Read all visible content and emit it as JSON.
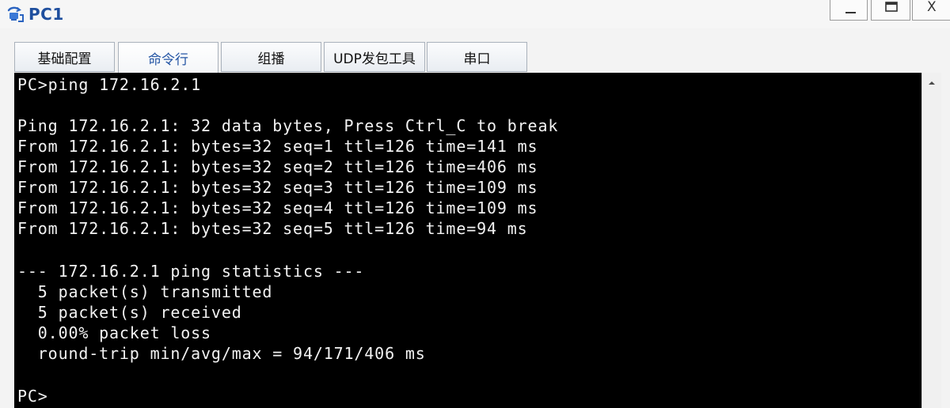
{
  "window": {
    "title": "PC1",
    "close_glyph": "X",
    "icons": [
      "pc-app-icon",
      "minimize-icon",
      "maximize-icon",
      "close-icon"
    ]
  },
  "tabs": [
    {
      "label": "基础配置",
      "active": false
    },
    {
      "label": "命令行",
      "active": true
    },
    {
      "label": "组播",
      "active": false
    },
    {
      "label": "UDP发包工具",
      "active": false
    },
    {
      "label": "串口",
      "active": false
    }
  ],
  "terminal": {
    "lines": [
      "PC>ping 172.16.2.1",
      "",
      "Ping 172.16.2.1: 32 data bytes, Press Ctrl_C to break",
      "From 172.16.2.1: bytes=32 seq=1 ttl=126 time=141 ms",
      "From 172.16.2.1: bytes=32 seq=2 ttl=126 time=406 ms",
      "From 172.16.2.1: bytes=32 seq=3 ttl=126 time=109 ms",
      "From 172.16.2.1: bytes=32 seq=4 ttl=126 time=109 ms",
      "From 172.16.2.1: bytes=32 seq=5 ttl=126 time=94 ms",
      "",
      "--- 172.16.2.1 ping statistics ---",
      "  5 packet(s) transmitted",
      "  5 packet(s) received",
      "  0.00% packet loss",
      "  round-trip min/avg/max = 94/171/406 ms",
      "",
      "PC>"
    ],
    "background_color": "#000000",
    "text_color": "#f2f2f2"
  },
  "colors": {
    "title": "#1f4f9e",
    "active_tab_text": "#2455a4"
  }
}
